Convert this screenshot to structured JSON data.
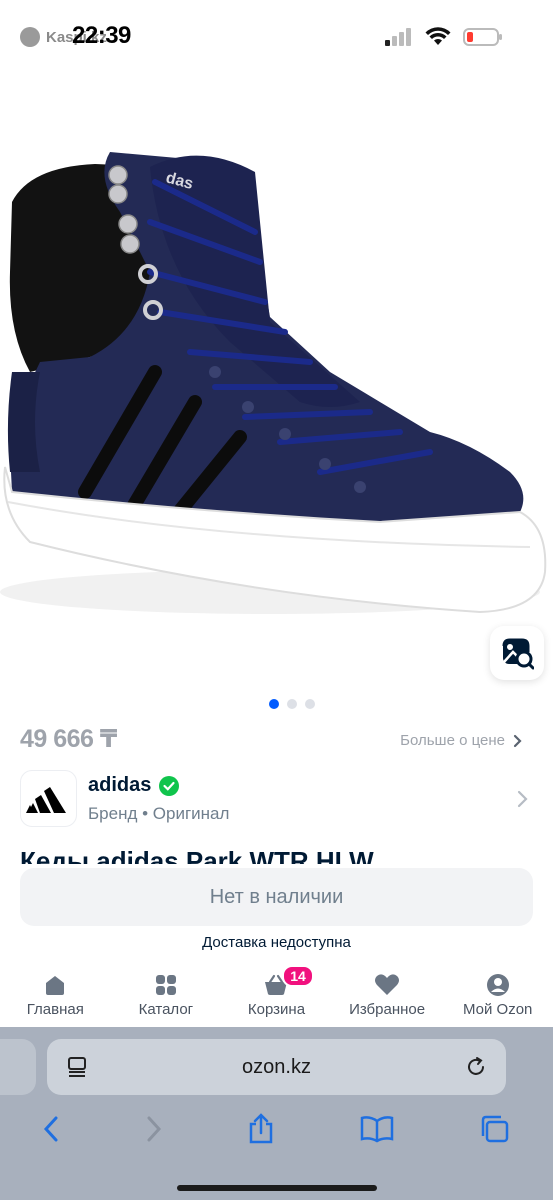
{
  "status_bar": {
    "back_app": "Kaspi.kz",
    "time": "22:39"
  },
  "product": {
    "image_alt": "adidas high-top sneaker navy",
    "pager_count": 3,
    "pager_active": 0,
    "price": "49 666 ₸",
    "more_price_label": "Больше о цене",
    "brand_name": "adidas",
    "brand_sub": "Бренд • Оригинал",
    "title": "Кеды adidas Park WTR HI W",
    "out_of_stock_label": "Нет в наличии",
    "delivery_label": "Доставка недоступна"
  },
  "bottom_nav": {
    "items": [
      {
        "label": "Главная",
        "icon": "home-icon"
      },
      {
        "label": "Каталог",
        "icon": "catalog-icon"
      },
      {
        "label": "Корзина",
        "icon": "cart-icon",
        "badge": "14"
      },
      {
        "label": "Избранное",
        "icon": "heart-icon"
      },
      {
        "label": "Мой Ozon",
        "icon": "profile-icon"
      }
    ]
  },
  "browser": {
    "url": "ozon.kz"
  },
  "colors": {
    "accent": "#005bff",
    "badge": "#f1117e",
    "verified": "#10c44c",
    "shoe_navy": "#232a55"
  }
}
